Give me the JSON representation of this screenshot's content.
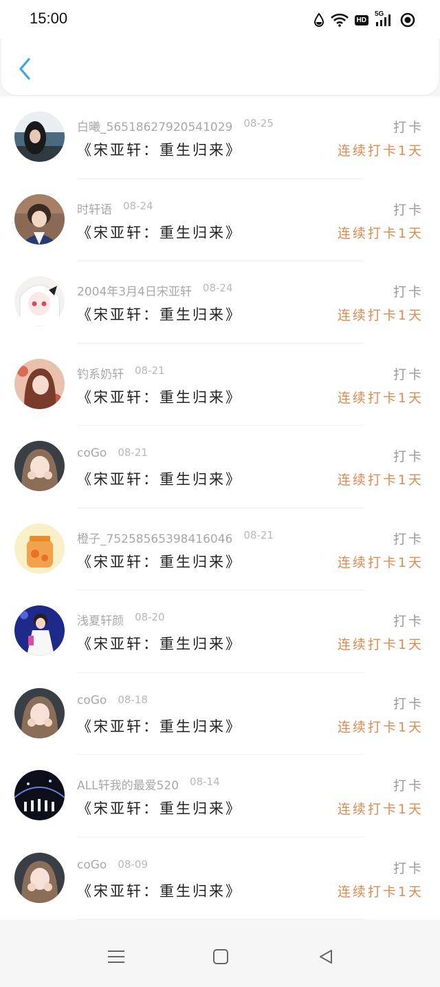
{
  "status_bar": {
    "time": "15:00",
    "icons": [
      "drop-icon",
      "wifi-icon",
      "hd-icon",
      "5g-signal-icon",
      "record-icon"
    ],
    "hd_label": "HD",
    "network_label": "5G"
  },
  "header": {
    "back_icon": "chevron-left-icon",
    "accent_color": "#3aa3e8"
  },
  "colors": {
    "streak": "#e2894e",
    "name": "#a8a8a8",
    "title": "#222222"
  },
  "entries": [
    {
      "name": "白曦_56518627920541029",
      "date": "08-25",
      "title": "《宋亚轩：重生归来》",
      "action": "打卡",
      "streak": "连续打卡1天"
    },
    {
      "name": "时轩语",
      "date": "08-24",
      "title": "《宋亚轩：重生归来》",
      "action": "打卡",
      "streak": "连续打卡1天"
    },
    {
      "name": "2004年3月4日宋亚轩",
      "date": "08-24",
      "title": "《宋亚轩：重生归来》",
      "action": "打卡",
      "streak": "连续打卡1天"
    },
    {
      "name": "钓系奶轩",
      "date": "08-21",
      "title": "《宋亚轩：重生归来》",
      "action": "打卡",
      "streak": "连续打卡1天"
    },
    {
      "name": "coGo",
      "date": "08-21",
      "title": "《宋亚轩：重生归来》",
      "action": "打卡",
      "streak": "连续打卡1天"
    },
    {
      "name": "橙子_75258565398416046",
      "date": "08-21",
      "title": "《宋亚轩：重生归来》",
      "action": "打卡",
      "streak": "连续打卡1天"
    },
    {
      "name": "浅夏轩颜",
      "date": "08-20",
      "title": "《宋亚轩：重生归来》",
      "action": "打卡",
      "streak": "连续打卡1天"
    },
    {
      "name": "coGo",
      "date": "08-18",
      "title": "《宋亚轩：重生归来》",
      "action": "打卡",
      "streak": "连续打卡1天"
    },
    {
      "name": "ALL轩我的最爱520",
      "date": "08-14",
      "title": "《宋亚轩：重生归来》",
      "action": "打卡",
      "streak": "连续打卡1天"
    },
    {
      "name": "coGo",
      "date": "08-09",
      "title": "《宋亚轩：重生归来》",
      "action": "打卡",
      "streak": "连续打卡1天"
    }
  ],
  "nav_bar": {
    "icons": [
      "menu-icon",
      "home-square-icon",
      "back-triangle-icon"
    ]
  }
}
